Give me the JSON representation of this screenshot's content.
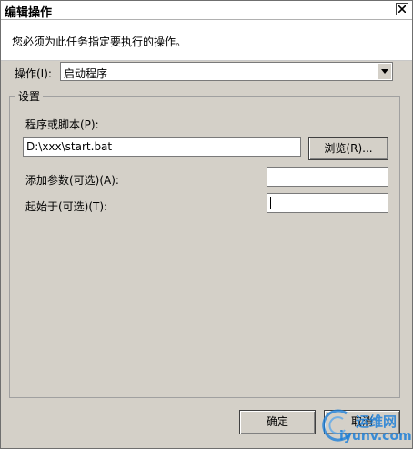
{
  "window": {
    "title": "编辑操作",
    "close_glyph": "×"
  },
  "instructions": "您必须为此任务指定要执行的操作。",
  "action": {
    "label": "操作(I):",
    "selected": "启动程序"
  },
  "settings": {
    "title": "设置",
    "program_label": "程序或脚本(P):",
    "program_value": "D:\\xxx\\start.bat",
    "browse_label": "浏览(R)...",
    "args_label": "添加参数(可选)(A):",
    "args_value": "",
    "startin_label": "起始于(可选)(T):",
    "startin_value": ""
  },
  "buttons": {
    "ok_label": "确定",
    "cancel_label": "取消"
  },
  "watermark": {
    "top_text": "运维网",
    "bottom_text": "iyunv.com"
  },
  "colors": {
    "dialog_bg": "#d4d0c8",
    "watermark": "#1e7fd8"
  }
}
